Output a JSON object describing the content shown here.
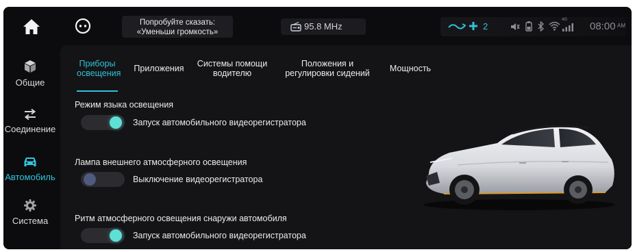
{
  "voice_hint": {
    "line1": "Попробуйте сказать:",
    "line2": "«Уменьши громкость»"
  },
  "radio": {
    "frequency": "95.8 MHz",
    "icon": "radio-icon"
  },
  "status_bar": {
    "link_count": "2",
    "signal_label": "4G",
    "time": "08:00",
    "ampm": "AM",
    "icons": [
      "phone-link-icon",
      "volume-icon",
      "battery-icon",
      "bluetooth-icon",
      "wifi-icon",
      "cellular-signal-icon"
    ]
  },
  "sidebar": {
    "items": [
      {
        "label": "Общие",
        "icon": "cube-icon",
        "active": false
      },
      {
        "label": "Соединение",
        "icon": "arrows-icon",
        "active": false
      },
      {
        "label": "Автомобиль",
        "icon": "car-icon",
        "active": true
      },
      {
        "label": "Система",
        "icon": "gear-icon",
        "active": false
      }
    ]
  },
  "tabs": [
    {
      "line1": "Приборы",
      "line2": "освещения",
      "active": true
    },
    {
      "line1": "Приложения",
      "line2": "",
      "active": false
    },
    {
      "line1": "Системы помощи",
      "line2": "водителю",
      "active": false
    },
    {
      "line1": "Положения и",
      "line2": "регулировки сидений",
      "active": false
    },
    {
      "line1": "Мощность",
      "line2": "",
      "active": false
    }
  ],
  "settings": [
    {
      "title": "Режим языка освещения",
      "toggle_on": true,
      "label": "Запуск автомобильного видеорегистратора"
    },
    {
      "title": "Лампа внешнего атмосферного освещения",
      "toggle_on": false,
      "label": "Выключение видеорегистратора"
    },
    {
      "title": "Ритм атмосферного освещения снаружи автомобиля",
      "toggle_on": true,
      "label": "Запуск автомобильного видеорегистратора"
    }
  ],
  "colors": {
    "accent": "#2fc3d6",
    "toggle_on_knob": "#5fe0d6",
    "toggle_off_knob": "#4f5a80",
    "background": "#0c0c0e",
    "panel": "#141417"
  }
}
